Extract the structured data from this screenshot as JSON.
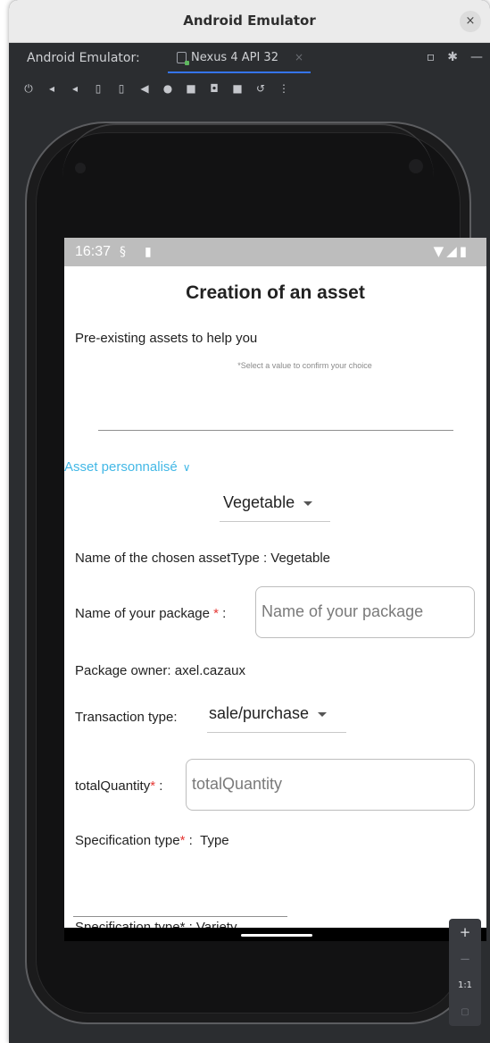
{
  "window": {
    "title": "Android Emulator",
    "close_glyph": "×"
  },
  "tabbar": {
    "prefix": "Android Emulator:",
    "device_tab": "Nexus 4 API 32",
    "close_glyph": "×"
  },
  "toolbar": {
    "icons": [
      "power-icon",
      "volume-up-icon",
      "volume-down-icon",
      "rotate-left-icon",
      "rotate-right-icon",
      "back-icon",
      "home-icon",
      "overview-icon",
      "screenshot-icon",
      "record-icon",
      "snapshot-icon",
      "more-icon"
    ]
  },
  "status_bar": {
    "time": "16:37"
  },
  "app": {
    "title": "Creation of an asset",
    "pre_existing_label": "Pre-existing assets to help you",
    "select_hint": "*Select a value to confirm your choice",
    "asset_link": "Asset personnalisé",
    "asset_type_dropdown": "Vegetable",
    "chosen_asset_type": "Name of the chosen assetType : Vegetable",
    "package_name_label": "Name of your package",
    "package_name_placeholder": "Name of your package",
    "package_owner": "Package owner: axel.cazaux",
    "transaction_label": "Transaction type:",
    "transaction_value": "sale/purchase",
    "total_quantity_label": "totalQuantity",
    "total_quantity_placeholder": "totalQuantity",
    "spec_type_label": "Specification type",
    "spec_type_value": "Type",
    "spec_type_partial": "Specification type* :  Variety",
    "required_mark": "*",
    "label_separator": " :"
  },
  "zoom": {
    "zoom_in": "+",
    "zoom_out": "−",
    "one_to_one": "1:1"
  },
  "colors": {
    "accent": "#43b8e6",
    "required": "#e53935",
    "tab_underline": "#3574f0"
  }
}
